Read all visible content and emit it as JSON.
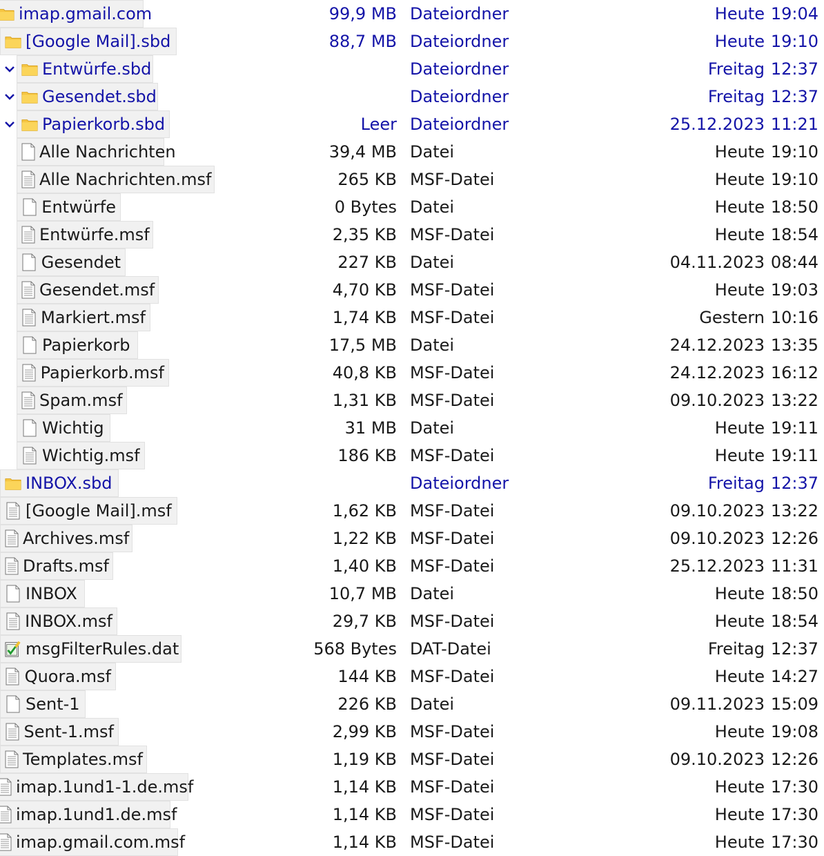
{
  "colors": {
    "folder_text": "#1414a8",
    "file_text": "#1a1a1a",
    "row_label_bg": "#f1f1f1",
    "folder_icon": "#f5c542"
  },
  "rows": [
    {
      "name": "imap.gmail.com",
      "size": "99,9 MB",
      "type": "Dateiordner",
      "day": "Heute",
      "time": "19:04",
      "icon": "folder-icon"
    },
    {
      "name": "[Google Mail].sbd",
      "size": "88,7 MB",
      "type": "Dateiordner",
      "day": "Heute",
      "time": "19:10",
      "icon": "folder-icon"
    },
    {
      "name": "Entwürfe.sbd",
      "size": "",
      "type": "Dateiordner",
      "day": "Freitag",
      "time": "12:37",
      "icon": "folder-icon"
    },
    {
      "name": "Gesendet.sbd",
      "size": "",
      "type": "Dateiordner",
      "day": "Freitag",
      "time": "12:37",
      "icon": "folder-icon"
    },
    {
      "name": "Papierkorb.sbd",
      "size": "Leer",
      "type": "Dateiordner",
      "day": "25.12.2023",
      "time": "11:21",
      "icon": "folder-icon"
    },
    {
      "name": "Alle Nachrichten",
      "size": "39,4 MB",
      "type": "Datei",
      "day": "Heute",
      "time": "19:10",
      "icon": "blank-file-icon"
    },
    {
      "name": "Alle Nachrichten.msf",
      "size": "265 KB",
      "type": "MSF-Datei",
      "day": "Heute",
      "time": "19:10",
      "icon": "text-file-icon"
    },
    {
      "name": "Entwürfe",
      "size": "0 Bytes",
      "type": "Datei",
      "day": "Heute",
      "time": "18:50",
      "icon": "blank-file-icon"
    },
    {
      "name": "Entwürfe.msf",
      "size": "2,35 KB",
      "type": "MSF-Datei",
      "day": "Heute",
      "time": "18:54",
      "icon": "text-file-icon"
    },
    {
      "name": "Gesendet",
      "size": "227 KB",
      "type": "Datei",
      "day": "04.11.2023",
      "time": "08:44",
      "icon": "blank-file-icon"
    },
    {
      "name": "Gesendet.msf",
      "size": "4,70 KB",
      "type": "MSF-Datei",
      "day": "Heute",
      "time": "19:03",
      "icon": "text-file-icon"
    },
    {
      "name": "Markiert.msf",
      "size": "1,74 KB",
      "type": "MSF-Datei",
      "day": "Gestern",
      "time": "10:16",
      "icon": "text-file-icon"
    },
    {
      "name": "Papierkorb",
      "size": "17,5 MB",
      "type": "Datei",
      "day": "24.12.2023",
      "time": "13:35",
      "icon": "blank-file-icon"
    },
    {
      "name": "Papierkorb.msf",
      "size": "40,8 KB",
      "type": "MSF-Datei",
      "day": "24.12.2023",
      "time": "16:12",
      "icon": "text-file-icon"
    },
    {
      "name": "Spam.msf",
      "size": "1,31 KB",
      "type": "MSF-Datei",
      "day": "09.10.2023",
      "time": "13:22",
      "icon": "text-file-icon"
    },
    {
      "name": "Wichtig",
      "size": "31 MB",
      "type": "Datei",
      "day": "Heute",
      "time": "19:11",
      "icon": "blank-file-icon"
    },
    {
      "name": "Wichtig.msf",
      "size": "186 KB",
      "type": "MSF-Datei",
      "day": "Heute",
      "time": "19:11",
      "icon": "text-file-icon"
    },
    {
      "name": "INBOX.sbd",
      "size": "",
      "type": "Dateiordner",
      "day": "Freitag",
      "time": "12:37",
      "icon": "folder-icon"
    },
    {
      "name": "[Google Mail].msf",
      "size": "1,62 KB",
      "type": "MSF-Datei",
      "day": "09.10.2023",
      "time": "13:22",
      "icon": "text-file-icon"
    },
    {
      "name": "Archives.msf",
      "size": "1,22 KB",
      "type": "MSF-Datei",
      "day": "09.10.2023",
      "time": "12:26",
      "icon": "text-file-icon"
    },
    {
      "name": "Drafts.msf",
      "size": "1,40 KB",
      "type": "MSF-Datei",
      "day": "25.12.2023",
      "time": "11:31",
      "icon": "text-file-icon"
    },
    {
      "name": "INBOX",
      "size": "10,7 MB",
      "type": "Datei",
      "day": "Heute",
      "time": "18:50",
      "icon": "blank-file-icon"
    },
    {
      "name": "INBOX.msf",
      "size": "29,7 KB",
      "type": "MSF-Datei",
      "day": "Heute",
      "time": "18:54",
      "icon": "text-file-icon"
    },
    {
      "name": "msgFilterRules.dat",
      "size": "568 Bytes",
      "type": "DAT-Datei",
      "day": "Freitag",
      "time": "12:37",
      "icon": "dat-file-icon"
    },
    {
      "name": "Quora.msf",
      "size": "144 KB",
      "type": "MSF-Datei",
      "day": "Heute",
      "time": "14:27",
      "icon": "text-file-icon"
    },
    {
      "name": "Sent-1",
      "size": "226 KB",
      "type": "Datei",
      "day": "09.11.2023",
      "time": "15:09",
      "icon": "blank-file-icon"
    },
    {
      "name": "Sent-1.msf",
      "size": "2,99 KB",
      "type": "MSF-Datei",
      "day": "Heute",
      "time": "19:08",
      "icon": "text-file-icon"
    },
    {
      "name": "Templates.msf",
      "size": "1,19 KB",
      "type": "MSF-Datei",
      "day": "09.10.2023",
      "time": "12:26",
      "icon": "text-file-icon"
    },
    {
      "name": "imap.1und1-1.de.msf",
      "size": "1,14 KB",
      "type": "MSF-Datei",
      "day": "Heute",
      "time": "17:30",
      "icon": "text-file-icon"
    },
    {
      "name": "imap.1und1.de.msf",
      "size": "1,14 KB",
      "type": "MSF-Datei",
      "day": "Heute",
      "time": "17:30",
      "icon": "text-file-icon"
    },
    {
      "name": "imap.gmail.com.msf",
      "size": "1,14 KB",
      "type": "MSF-Datei",
      "day": "Heute",
      "time": "17:30",
      "icon": "text-file-icon"
    }
  ]
}
